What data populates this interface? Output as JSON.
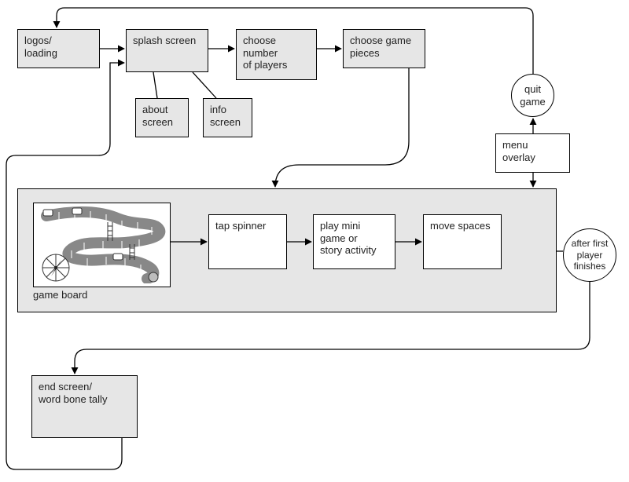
{
  "nodes": {
    "logos": {
      "text": "logos/\nloading"
    },
    "splash": {
      "text": "splash screen"
    },
    "choose_num": {
      "text": "choose\nnumber\nof players"
    },
    "choose_piece": {
      "text": "choose game\npieces"
    },
    "about": {
      "text": "about\nscreen"
    },
    "info": {
      "text": "info\nscreen"
    },
    "quit": {
      "text": "quit\ngame"
    },
    "menu": {
      "text": "menu overlay"
    },
    "game_label": {
      "text": "game board"
    },
    "tap": {
      "text": "tap spinner"
    },
    "play_mini": {
      "text": "play mini\ngame or\nstory activity"
    },
    "move": {
      "text": "move spaces"
    },
    "after": {
      "text": "after first\nplayer\nfinishes"
    },
    "end": {
      "text": "end screen/\nword bone tally"
    }
  }
}
